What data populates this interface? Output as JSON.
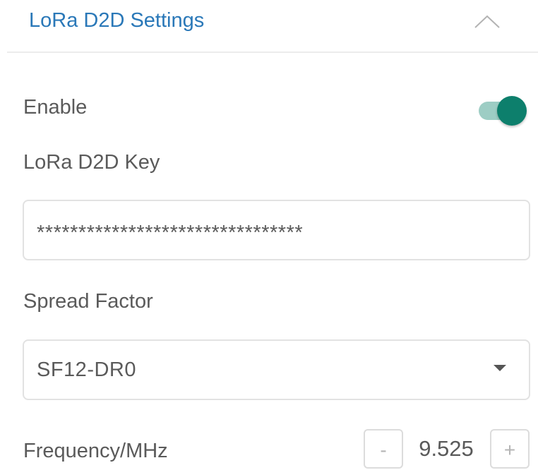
{
  "section": {
    "title": "LoRa D2D Settings",
    "collapse_icon": "chevron-up-icon"
  },
  "enable": {
    "label": "Enable",
    "checked": true,
    "color_on": "#0d7f6c"
  },
  "key": {
    "label": "LoRa D2D Key",
    "value": "********************************"
  },
  "spread_factor": {
    "label": "Spread Factor",
    "value": "SF12-DR0",
    "dropdown_icon": "caret-down-icon"
  },
  "frequency": {
    "label": "Frequency/MHz",
    "decrement": "-",
    "value": "9.525",
    "increment": "+"
  },
  "colors": {
    "accent": "#2a78b8",
    "toggle_on": "#0d7f6c",
    "text": "#5a5a5a"
  }
}
